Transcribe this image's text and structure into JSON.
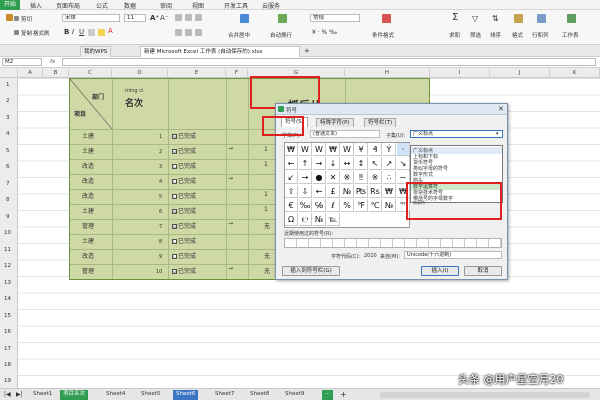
{
  "menu": {
    "start": "开始",
    "items": [
      "插入",
      "页面布局",
      "公式",
      "数据",
      "审阅",
      "视图",
      "开发工具",
      "云服务"
    ]
  },
  "ribbon": {
    "cut": "剪切",
    "copy": "复制",
    "format_painter": "格式刷",
    "font_name": "宋体",
    "font_size": "11",
    "merge_center": "合并居中",
    "wrap_text": "自动换行",
    "number_format": "常规",
    "conditional_format": "条件格式",
    "sum": "求和",
    "filter": "筛选",
    "sort": "排序",
    "format": "格式",
    "row_col": "行和列",
    "sheet": "工作表"
  },
  "doc_tabs": {
    "mywps": "我的WPS",
    "file": "新建 Microsoft Excel 工作表 (自动保存的).xlsx"
  },
  "formula_bar": {
    "cell_ref": "M2",
    "fx": "fx"
  },
  "columns": [
    "A",
    "B",
    "C",
    "D",
    "E",
    "F",
    "G",
    "H",
    "I",
    "J",
    "K"
  ],
  "rows": [
    "1",
    "2",
    "3",
    "4",
    "5",
    "6",
    "7",
    "8",
    "9",
    "10",
    "11",
    "12",
    "13",
    "14",
    "15",
    "16",
    "17",
    "18",
    "19"
  ],
  "table": {
    "header_dept": "部门",
    "header_item": "项目",
    "pinyin": "míng cì",
    "header_rank": "名次",
    "large_header": "抓后儿",
    "rows": [
      {
        "item": "土建",
        "num": "1",
        "checked": "☑",
        "status": "已完成",
        "arrow": "",
        "extra": ""
      },
      {
        "item": "土建",
        "num": "2",
        "checked": "☑",
        "status": "已完成",
        "arrow": "→",
        "extra": "1"
      },
      {
        "item": "改造",
        "num": "3",
        "checked": "☐",
        "status": "已完成",
        "arrow": "",
        "extra": "1"
      },
      {
        "item": "改造",
        "num": "4",
        "checked": "☐",
        "status": "已完成",
        "arrow": "→",
        "extra": ""
      },
      {
        "item": "改造",
        "num": "5",
        "checked": "☐",
        "status": "已完成",
        "arrow": "",
        "extra": "1"
      },
      {
        "item": "土建",
        "num": "6",
        "checked": "☑",
        "status": "已完成",
        "arrow": "",
        "extra": "1"
      },
      {
        "item": "管理",
        "num": "7",
        "checked": "☑",
        "status": "已完成",
        "arrow": "→",
        "extra": "无"
      },
      {
        "item": "土建",
        "num": "8",
        "checked": "☐",
        "status": "已完成",
        "arrow": "",
        "extra": ""
      },
      {
        "item": "改造",
        "num": "9",
        "checked": "☐",
        "status": "已完成",
        "arrow": "",
        "extra": "无"
      },
      {
        "item": "管理",
        "num": "10",
        "checked": "☑",
        "status": "已完成",
        "arrow": "→",
        "extra": "无"
      }
    ]
  },
  "dialog": {
    "title": "符号",
    "tabs": [
      "符号(S)",
      "特殊字符(P)",
      "符号栏(T)"
    ],
    "font_label": "字体(F):",
    "font_value": "(普通文本)",
    "subset_label": "子集(U):",
    "subset_value": "广义标点",
    "symbols": [
      "₩",
      "W",
      "W",
      "₩",
      "W",
      "¥",
      "₰",
      "Ý",
      "·",
      "←",
      "↑",
      "→",
      "↓",
      "↔",
      "↕",
      "↖",
      "↗",
      "↘",
      "↙",
      "→",
      "●",
      "✕",
      "※",
      "‼",
      "※",
      "∴",
      "∽",
      "⇧",
      "⇩",
      "←",
      "£",
      "№",
      "₧",
      "Rs",
      "₩",
      "₩",
      "€",
      "‰",
      "℅",
      "ℓ",
      "%",
      "℉",
      "℃",
      "№",
      "™",
      "Ω",
      "℮",
      "№",
      "℡"
    ],
    "subset_items": [
      "广义标点",
      "上标和下标",
      "货币符号",
      "类似字母的符号",
      "数字形式",
      "箭头",
      "数学运算符",
      "零杂技术符号",
      "带括号的字母数字",
      "制表符"
    ],
    "recent_label": "近期使用过的符号(R):",
    "code_label": "字符代码(C):",
    "code_value": "2010",
    "from_label": "来自(M):",
    "from_value": "Unicode(十六进制)",
    "insert_button": "插入(I)",
    "cancel_button": "取消",
    "insert_bar_button": "插入到符号栏(G)"
  },
  "sheet_tabs": [
    "Sheet1",
    "项目名次",
    "Sheet4",
    "Sheet5",
    "Sheet6",
    "Sheet7",
    "Sheet8",
    "Sheet9"
  ],
  "watermark": "头条 @用户星空月20"
}
